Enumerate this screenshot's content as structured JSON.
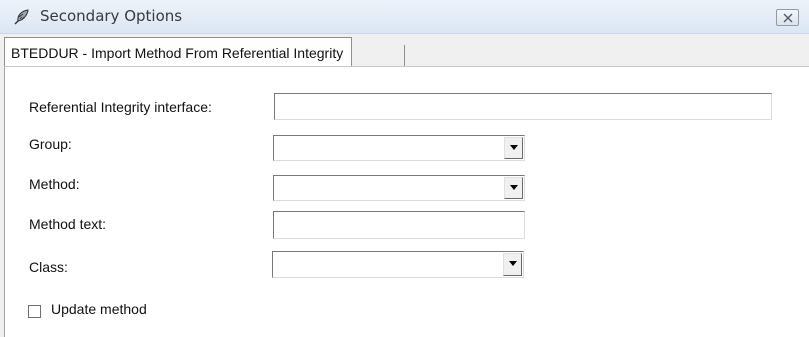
{
  "window": {
    "title": "Secondary Options",
    "icon": "feather-icon",
    "close_icon": "close-icon"
  },
  "tabs": [
    {
      "label": "BTEDDUR - Import Method From Referential Integrity",
      "active": true
    }
  ],
  "form": {
    "ri_interface": {
      "label": "Referential Integrity interface:",
      "value": ""
    },
    "group": {
      "label": "Group:",
      "value": ""
    },
    "method": {
      "label": "Method:",
      "value": ""
    },
    "method_text": {
      "label": "Method text:",
      "value": ""
    },
    "class": {
      "label": "Class:",
      "value": ""
    },
    "update_method": {
      "label": "Update method",
      "checked": false
    }
  }
}
